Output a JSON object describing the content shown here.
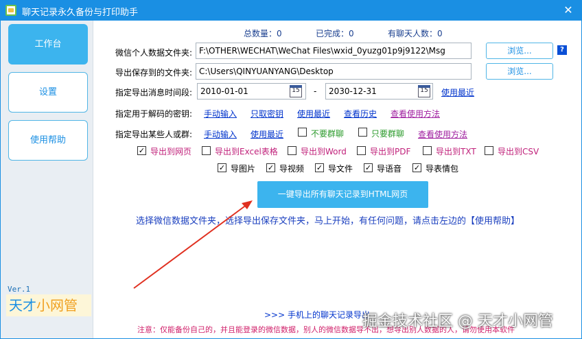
{
  "window": {
    "title": "聊天记录永久备份与打印助手",
    "close": "✕"
  },
  "sidebar": {
    "items": [
      {
        "label": "工作台",
        "active": true
      },
      {
        "label": "设置",
        "active": false
      },
      {
        "label": "使用帮助",
        "active": false
      }
    ],
    "version": "Ver.1",
    "logo_part1": "天才",
    "logo_part2": "小网管"
  },
  "stats": {
    "total": "总数量：0",
    "done": "已完成：0",
    "contacts": "有聊天人数：0"
  },
  "form": {
    "data_folder_label": "微信个人数据文件夹:",
    "data_folder_value": "F:\\OTHER\\WECHAT\\WeChat Files\\wxid_0yuzg01p9j9122\\Msg",
    "save_folder_label": "导出保存到的文件夹:",
    "save_folder_value": "C:\\Users\\QINYUANYANG\\Desktop",
    "browse": "浏览...",
    "help_q": "?",
    "date_label": "指定导出消息时间段:",
    "date_from": "2010-01-01",
    "date_to": "2030-12-31",
    "date_sep": "-",
    "calendar_num": "15",
    "use_recent": "使用最近",
    "key_label": "指定用于解码的密钥:",
    "key_links": [
      "手动输入",
      "只取密钥",
      "使用最近",
      "查看历史"
    ],
    "key_help": "查看使用方法",
    "group_label": "指定导出某些人或群:",
    "group_links": [
      "手动输入",
      "使用最近"
    ],
    "no_group": "不要群聊",
    "only_group": "只要群聊",
    "group_help": "查看使用方法"
  },
  "export_options": [
    {
      "label": "导出到网页",
      "checked": true
    },
    {
      "label": "导出到Excel表格",
      "checked": false
    },
    {
      "label": "导出到Word",
      "checked": false
    },
    {
      "label": "导出到PDF",
      "checked": false
    },
    {
      "label": "导出到TXT",
      "checked": false
    },
    {
      "label": "导出到CSV",
      "checked": false
    }
  ],
  "media_options": [
    {
      "label": "导图片",
      "checked": true
    },
    {
      "label": "导视频",
      "checked": true
    },
    {
      "label": "导文件",
      "checked": true
    },
    {
      "label": "导语音",
      "checked": true
    },
    {
      "label": "导表情包",
      "checked": true
    }
  ],
  "main_button": "一键导出所有聊天记录到HTML网页",
  "tip": "选择微信数据文件夹，选择导出保存文件夹，马上开始，有任何问题，请点击左边的【使用帮助】",
  "mobile_link": ">>>  手机上的聊天记录导出",
  "note": "注意：仅能备份自己的，并且能登录的微信数据，别人的微信数据导不出，想导出别人数据的人，请勿使用本软件",
  "watermark": "掘金技术社区 @ 天才小网管",
  "colors": {
    "titlebar": "#1a8fe3",
    "accent": "#3cb4ee",
    "link": "#0033cc",
    "warning": "#d0206a"
  }
}
